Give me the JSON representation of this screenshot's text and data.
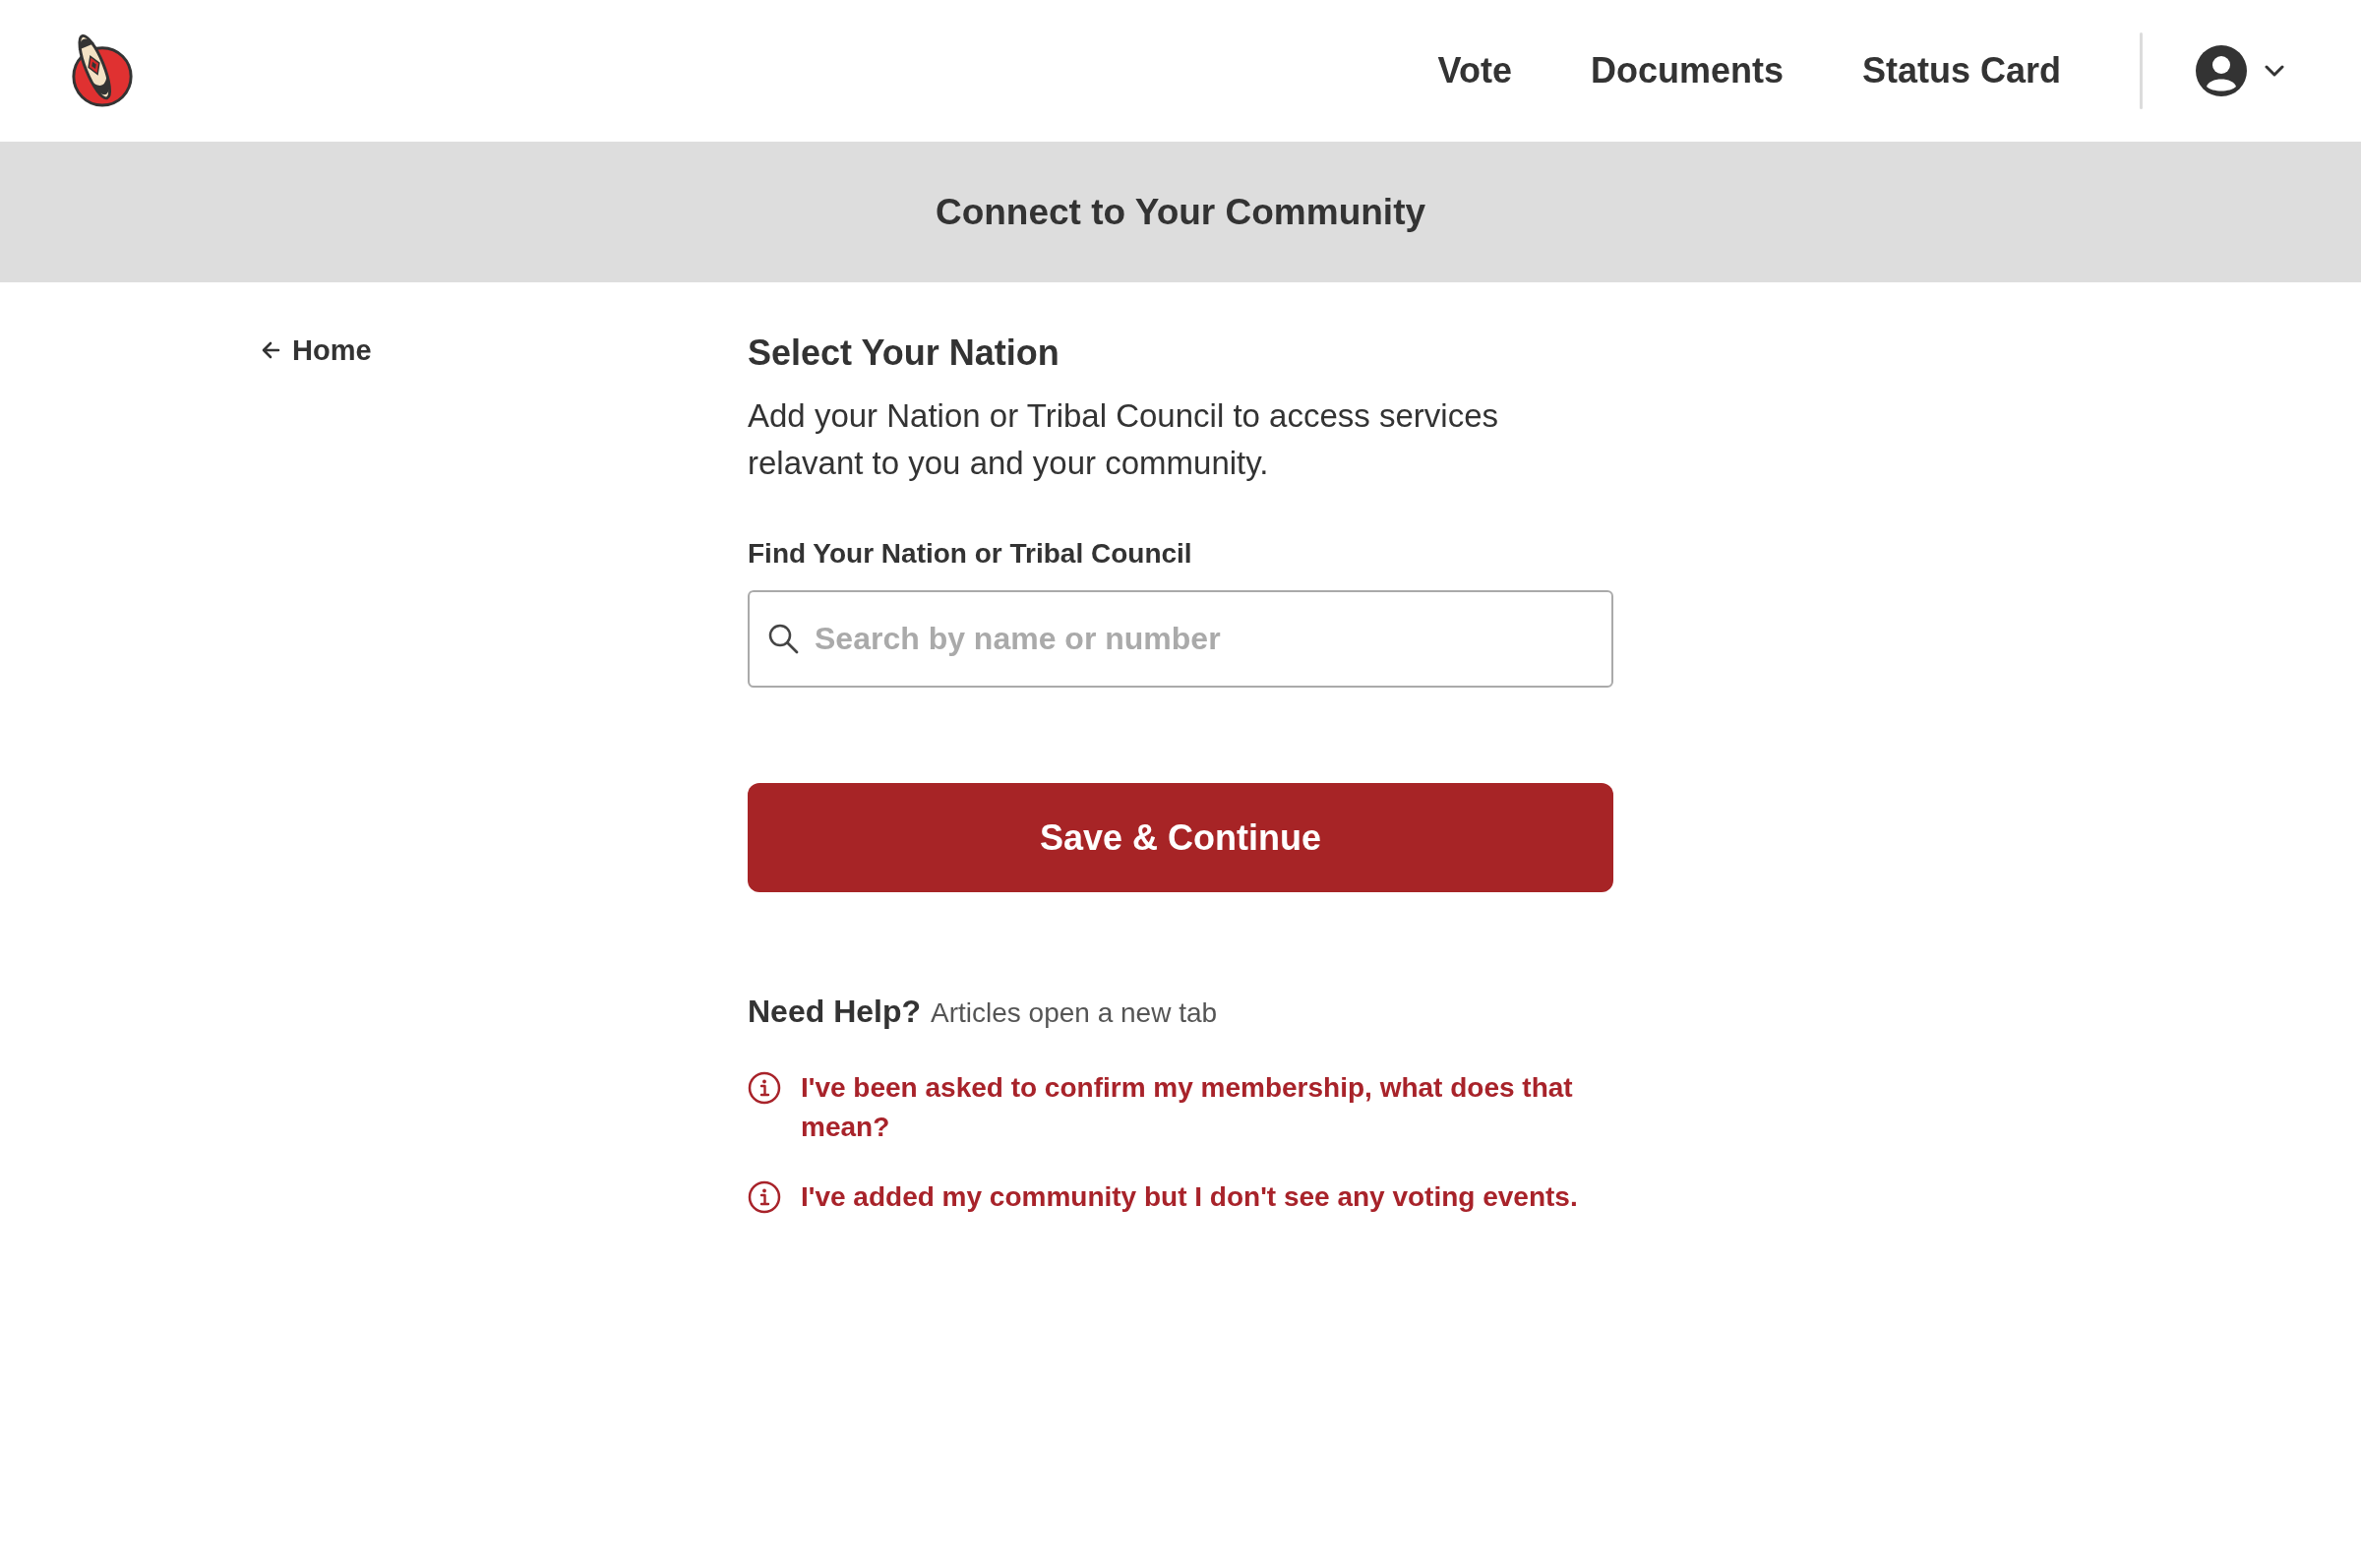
{
  "header": {
    "nav": [
      "Vote",
      "Documents",
      "Status Card"
    ]
  },
  "banner": {
    "title": "Connect to Your Community"
  },
  "back_link": "Home",
  "form": {
    "heading": "Select Your Nation",
    "description": "Add your Nation or Tribal Council to access services relavant to you and your community.",
    "search": {
      "label": "Find Your Nation or Tribal Council",
      "placeholder": "Search by name or number"
    },
    "submit": "Save & Continue"
  },
  "help": {
    "title": "Need Help?",
    "note": "Articles open a new tab",
    "articles": [
      "I've been asked to confirm my membership, what does that mean?",
      "I've added my community but I don't see any voting events."
    ]
  }
}
